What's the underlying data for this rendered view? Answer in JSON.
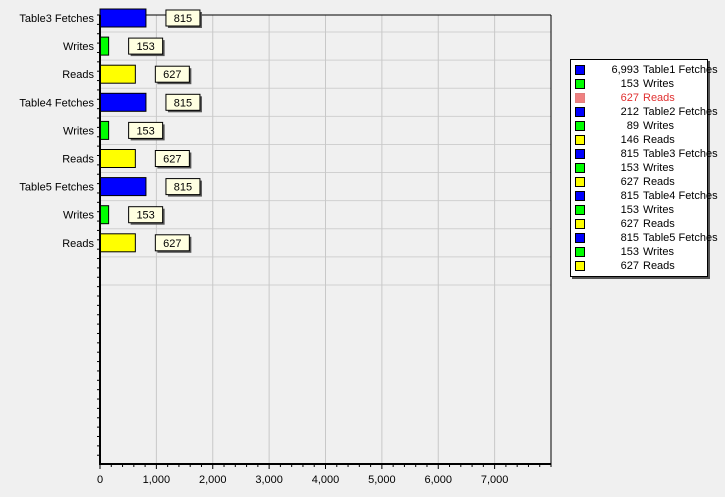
{
  "chart_data": {
    "type": "bar",
    "orientation": "horizontal",
    "xlim": [
      0,
      8000
    ],
    "x_ticks": [
      "0",
      "1,000",
      "2,000",
      "3,000",
      "4,000",
      "5,000",
      "6,000",
      "7,000"
    ],
    "x_tick_values": [
      0,
      1000,
      2000,
      3000,
      4000,
      5000,
      6000,
      7000
    ],
    "grid": true,
    "legend_position": "right",
    "colors": {
      "Fetches": "#0000ff",
      "Writes": "#00ff00",
      "Reads": "#ffff00",
      "highlight": "#f08080"
    },
    "bars": [
      {
        "label": "Table3 Fetches",
        "value": 815,
        "value_label": "815",
        "kind": "Fetches"
      },
      {
        "label": "Writes",
        "value": 153,
        "value_label": "153",
        "kind": "Writes"
      },
      {
        "label": "Reads",
        "value": 627,
        "value_label": "627",
        "kind": "Reads"
      },
      {
        "label": "Table4 Fetches",
        "value": 815,
        "value_label": "815",
        "kind": "Fetches"
      },
      {
        "label": "Writes",
        "value": 153,
        "value_label": "153",
        "kind": "Writes"
      },
      {
        "label": "Reads",
        "value": 627,
        "value_label": "627",
        "kind": "Reads"
      },
      {
        "label": "Table5 Fetches",
        "value": 815,
        "value_label": "815",
        "kind": "Fetches"
      },
      {
        "label": "Writes",
        "value": 153,
        "value_label": "153",
        "kind": "Writes"
      },
      {
        "label": "Reads",
        "value": 627,
        "value_label": "627",
        "kind": "Reads"
      }
    ],
    "legend": [
      {
        "value": "6,993",
        "name": "Table1 Fetches",
        "kind": "Fetches"
      },
      {
        "value": "153",
        "name": "Writes",
        "kind": "Writes"
      },
      {
        "value": "627",
        "name": "Reads",
        "kind": "Reads",
        "highlighted": true
      },
      {
        "value": "212",
        "name": "Table2 Fetches",
        "kind": "Fetches"
      },
      {
        "value": "89",
        "name": "Writes",
        "kind": "Writes"
      },
      {
        "value": "146",
        "name": "Reads",
        "kind": "Reads"
      },
      {
        "value": "815",
        "name": "Table3 Fetches",
        "kind": "Fetches"
      },
      {
        "value": "153",
        "name": "Writes",
        "kind": "Writes"
      },
      {
        "value": "627",
        "name": "Reads",
        "kind": "Reads"
      },
      {
        "value": "815",
        "name": "Table4 Fetches",
        "kind": "Fetches"
      },
      {
        "value": "153",
        "name": "Writes",
        "kind": "Writes"
      },
      {
        "value": "627",
        "name": "Reads",
        "kind": "Reads"
      },
      {
        "value": "815",
        "name": "Table5 Fetches",
        "kind": "Fetches"
      },
      {
        "value": "153",
        "name": "Writes",
        "kind": "Writes"
      },
      {
        "value": "627",
        "name": "Reads",
        "kind": "Reads"
      }
    ]
  }
}
